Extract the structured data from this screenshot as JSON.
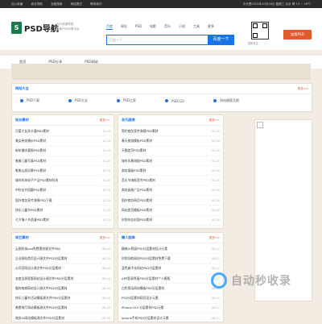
{
  "topbar": {
    "links": [
      "加入收藏",
      "综合导航",
      "全能搜索",
      "网站提交",
      "联系我们"
    ],
    "date": "今天是2024年10月16日  星期三  北京  晴 13 ~ 18℃"
  },
  "header": {
    "logo_mark": "S",
    "logo_text": "PSD导航",
    "slogan_line1": "PSD资源导航",
    "slogan_line2": "最新PSD分享平台",
    "search_tabs": [
      "百度",
      "网址",
      "PSD",
      "电影",
      "音乐",
      "小说",
      "工具",
      "更多"
    ],
    "search_placeholder": "百度一下",
    "search_button": "百度一下",
    "qr_caption": "扫码关注",
    "add_button": "加我PSD"
  },
  "nav": {
    "items": [
      "首页",
      "PSD分享",
      "PSD网站"
    ]
  },
  "site_box": {
    "title": "网站大全",
    "more": "更多>>",
    "tags": [
      "PSD下载",
      "PSD大全",
      "PSD之家",
      "PSD123",
      "网站模版互换"
    ]
  },
  "lists": [
    {
      "title": "站长素材",
      "items": [
        {
          "t": "可爱小女孩卡通PSD素材",
          "d": "12-23"
        },
        {
          "t": "美女卷发婚纱PSD素材",
          "d": "12-23"
        },
        {
          "t": "新年婚庆喜报PSD素材",
          "d": "12-23"
        },
        {
          "t": "唯美儿童写真PSD素材",
          "d": "12-23"
        },
        {
          "t": "唯美山居风景PSD素材",
          "d": "12-23"
        },
        {
          "t": "城市科技电子产品PSD素材科技",
          "d": "12-23"
        },
        {
          "t": "中秋佳节团圆PSD素材",
          "d": "12-23"
        },
        {
          "t": "国外商务宣传海报PSD下载",
          "d": "12-23"
        },
        {
          "t": "快乐儿童节PSD素材",
          "d": "12-23"
        },
        {
          "t": "七夕情人节浪漫PSD素材",
          "d": "12-23"
        }
      ]
    },
    {
      "title": "非凡图库",
      "items": [
        {
          "t": "简约商务宣传海报PSD素材",
          "d": "03-30"
        },
        {
          "t": "春天旅游模板PSD素材",
          "d": "03-30"
        },
        {
          "t": "天猫首页PSD素材",
          "d": "03-30"
        },
        {
          "t": "城市风景海报PSD素材",
          "d": "03-30"
        },
        {
          "t": "商务展板PSD素材",
          "d": "03-30"
        },
        {
          "t": "音乐节海报宣传PSD素材",
          "d": "03-30"
        },
        {
          "t": "商务画册广告PSD素材",
          "d": "03-30"
        },
        {
          "t": "国外商务网页PSD素材",
          "d": "03-30"
        },
        {
          "t": "网站首页模板PSD素材",
          "d": "03-30"
        },
        {
          "t": "时尚杂志封面PSD素材",
          "d": "03-30"
        }
      ]
    },
    {
      "title": "纯艺素材",
      "items": [
        {
          "t": "云图科技psd免费素材源文件PSD",
          "d": "06-24"
        },
        {
          "t": "企业网站首页设计源文件PSD分层素材",
          "d": "06-24"
        },
        {
          "t": "公司官网设计源文件PSD分层素材",
          "d": "06-24"
        },
        {
          "t": "态度全屏宽版网站设计源文件PSD分层素材",
          "d": "06-24"
        },
        {
          "t": "服饰电商网站设计源文件PSD分层素材",
          "d": "06-24"
        },
        {
          "t": "快乐儿童节活动模板源文件PSD分层素材",
          "d": "06-24"
        },
        {
          "t": "美食餐厅网站模板源文件PSD分层素材",
          "d": "06-24"
        },
        {
          "t": "商务UI网站模板源文件PSD分层素材",
          "d": "06-24"
        }
      ]
    },
    {
      "title": "懒人图库",
      "items": [
        {
          "t": "精美UI界面PSD分层素材设计元素",
          "d": "06-11"
        },
        {
          "t": "时尚导航网站PSD分层素材免费下载",
          "d": "06-11"
        },
        {
          "t": "蓝色扁平化网站PSD分层素材",
          "d": "06-11"
        },
        {
          "t": "APP登录界面PSD分层素材个人模版",
          "d": "06-11"
        },
        {
          "t": "白色简洁网站模板PSD分层素材",
          "d": "06-11"
        },
        {
          "t": "PSD分层素材网页设计元素",
          "d": "06-11"
        },
        {
          "t": "iPhone GUI 分层素材PSD元素",
          "d": "06-11"
        },
        {
          "t": "iphone手机PSD分层素材设计元素",
          "d": "06-11"
        }
      ]
    }
  ],
  "watermark": "自动秒收录",
  "colors": {
    "accent": "#1a73e8",
    "brand": "#1c7a4b",
    "orange": "#e05a2b",
    "bg": "#f3ece3"
  }
}
